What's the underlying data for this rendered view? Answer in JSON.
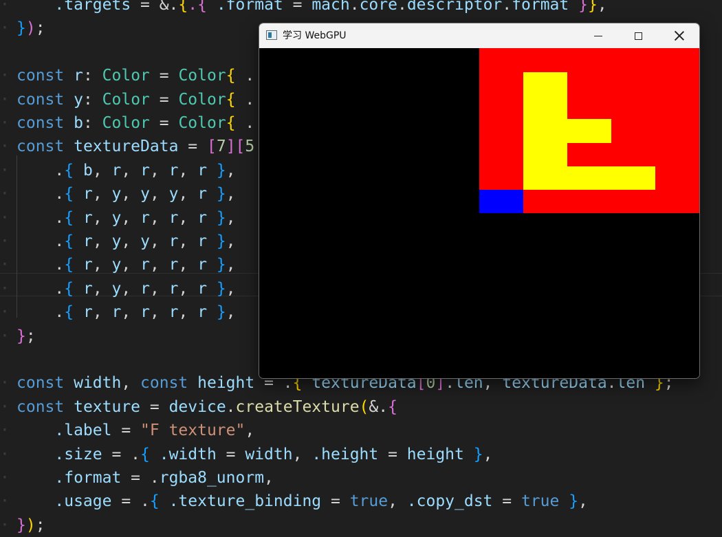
{
  "window": {
    "title": "学习 WebGPU",
    "minimize_label": "Minimize",
    "maximize_label": "Maximize",
    "close_label": "Close"
  },
  "texture_colors": {
    "r": "#ff0000",
    "y": "#ffff00",
    "b": "#0000ff"
  },
  "texture_rows": [
    [
      "b",
      "r",
      "r",
      "r",
      "r"
    ],
    [
      "r",
      "y",
      "y",
      "y",
      "r"
    ],
    [
      "r",
      "y",
      "r",
      "r",
      "r"
    ],
    [
      "r",
      "y",
      "y",
      "r",
      "r"
    ],
    [
      "r",
      "y",
      "r",
      "r",
      "r"
    ],
    [
      "r",
      "y",
      "r",
      "r",
      "r"
    ],
    [
      "r",
      "r",
      "r",
      "r",
      "r"
    ]
  ],
  "code_lines": [
    [
      [
        "t-field",
        "    .targets"
      ],
      [
        "t-op",
        " = &."
      ],
      [
        "t-b1",
        "{"
      ],
      [
        "t-b2",
        ".{"
      ],
      [
        "t-field",
        " .format"
      ],
      [
        "t-op",
        " = "
      ],
      [
        "t-var",
        "mach"
      ],
      [
        "t-op",
        "."
      ],
      [
        "t-var",
        "core"
      ],
      [
        "t-op",
        "."
      ],
      [
        "t-var",
        "descriptor"
      ],
      [
        "t-op",
        "."
      ],
      [
        "t-var",
        "format"
      ],
      [
        "t-b2",
        " }"
      ],
      [
        "t-b1",
        "}"
      ],
      [
        "t-op",
        ","
      ]
    ],
    [
      [
        "t-b3",
        "}"
      ],
      [
        "t-b2",
        ")"
      ],
      [
        "t-op",
        ";"
      ]
    ],
    [],
    [
      [
        "t-kw",
        "const"
      ],
      [
        "t-var",
        " r"
      ],
      [
        "t-op",
        ": "
      ],
      [
        "t-type",
        "Color"
      ],
      [
        "t-op",
        " = "
      ],
      [
        "t-type",
        "Color"
      ],
      [
        "t-b1",
        "{"
      ],
      [
        "t-op",
        " ."
      ]
    ],
    [
      [
        "t-kw",
        "const"
      ],
      [
        "t-var",
        " y"
      ],
      [
        "t-op",
        ": "
      ],
      [
        "t-type",
        "Color"
      ],
      [
        "t-op",
        " = "
      ],
      [
        "t-type",
        "Color"
      ],
      [
        "t-b1",
        "{"
      ],
      [
        "t-op",
        " ."
      ]
    ],
    [
      [
        "t-kw",
        "const"
      ],
      [
        "t-var",
        " b"
      ],
      [
        "t-op",
        ": "
      ],
      [
        "t-type",
        "Color"
      ],
      [
        "t-op",
        " = "
      ],
      [
        "t-type",
        "Color"
      ],
      [
        "t-b1",
        "{"
      ],
      [
        "t-op",
        " ."
      ]
    ],
    [
      [
        "t-kw",
        "const"
      ],
      [
        "t-var",
        " textureData"
      ],
      [
        "t-op",
        " = "
      ],
      [
        "t-b2",
        "["
      ],
      [
        "t-num",
        "7"
      ],
      [
        "t-b2",
        "]"
      ],
      [
        "t-b2",
        "["
      ],
      [
        "t-num",
        "5"
      ]
    ],
    [
      [
        "t-op",
        "    ."
      ],
      [
        "t-b3",
        "{"
      ],
      [
        "t-var",
        " b"
      ],
      [
        "t-op",
        ", "
      ],
      [
        "t-var",
        "r"
      ],
      [
        "t-op",
        ", "
      ],
      [
        "t-var",
        "r"
      ],
      [
        "t-op",
        ", "
      ],
      [
        "t-var",
        "r"
      ],
      [
        "t-op",
        ", "
      ],
      [
        "t-var",
        "r"
      ],
      [
        "t-b3",
        " }"
      ],
      [
        "t-op",
        ","
      ]
    ],
    [
      [
        "t-op",
        "    ."
      ],
      [
        "t-b3",
        "{"
      ],
      [
        "t-var",
        " r"
      ],
      [
        "t-op",
        ", "
      ],
      [
        "t-var",
        "y"
      ],
      [
        "t-op",
        ", "
      ],
      [
        "t-var",
        "y"
      ],
      [
        "t-op",
        ", "
      ],
      [
        "t-var",
        "y"
      ],
      [
        "t-op",
        ", "
      ],
      [
        "t-var",
        "r"
      ],
      [
        "t-b3",
        " }"
      ],
      [
        "t-op",
        ","
      ]
    ],
    [
      [
        "t-op",
        "    ."
      ],
      [
        "t-b3",
        "{"
      ],
      [
        "t-var",
        " r"
      ],
      [
        "t-op",
        ", "
      ],
      [
        "t-var",
        "y"
      ],
      [
        "t-op",
        ", "
      ],
      [
        "t-var",
        "r"
      ],
      [
        "t-op",
        ", "
      ],
      [
        "t-var",
        "r"
      ],
      [
        "t-op",
        ", "
      ],
      [
        "t-var",
        "r"
      ],
      [
        "t-b3",
        " }"
      ],
      [
        "t-op",
        ","
      ]
    ],
    [
      [
        "t-op",
        "    ."
      ],
      [
        "t-b3",
        "{"
      ],
      [
        "t-var",
        " r"
      ],
      [
        "t-op",
        ", "
      ],
      [
        "t-var",
        "y"
      ],
      [
        "t-op",
        ", "
      ],
      [
        "t-var",
        "y"
      ],
      [
        "t-op",
        ", "
      ],
      [
        "t-var",
        "r"
      ],
      [
        "t-op",
        ", "
      ],
      [
        "t-var",
        "r"
      ],
      [
        "t-b3",
        " }"
      ],
      [
        "t-op",
        ","
      ]
    ],
    [
      [
        "t-op",
        "    ."
      ],
      [
        "t-b3",
        "{"
      ],
      [
        "t-var",
        " r"
      ],
      [
        "t-op",
        ", "
      ],
      [
        "t-var",
        "y"
      ],
      [
        "t-op",
        ", "
      ],
      [
        "t-var",
        "r"
      ],
      [
        "t-op",
        ", "
      ],
      [
        "t-var",
        "r"
      ],
      [
        "t-op",
        ", "
      ],
      [
        "t-var",
        "r"
      ],
      [
        "t-b3",
        " }"
      ],
      [
        "t-op",
        ","
      ]
    ],
    [
      [
        "t-op",
        "    ."
      ],
      [
        "t-b3",
        "{"
      ],
      [
        "t-var",
        " r"
      ],
      [
        "t-op",
        ", "
      ],
      [
        "t-var",
        "y"
      ],
      [
        "t-op",
        ", "
      ],
      [
        "t-var",
        "r"
      ],
      [
        "t-op",
        ", "
      ],
      [
        "t-var",
        "r"
      ],
      [
        "t-op",
        ", "
      ],
      [
        "t-var",
        "r"
      ],
      [
        "t-b3",
        " }"
      ],
      [
        "t-op",
        ","
      ]
    ],
    [
      [
        "t-op",
        "    ."
      ],
      [
        "t-b3",
        "{"
      ],
      [
        "t-var",
        " r"
      ],
      [
        "t-op",
        ", "
      ],
      [
        "t-var",
        "r"
      ],
      [
        "t-op",
        ", "
      ],
      [
        "t-var",
        "r"
      ],
      [
        "t-op",
        ", "
      ],
      [
        "t-var",
        "r"
      ],
      [
        "t-op",
        ", "
      ],
      [
        "t-var",
        "r"
      ],
      [
        "t-b3",
        " }"
      ],
      [
        "t-op",
        ","
      ]
    ],
    [
      [
        "t-b2",
        "}"
      ],
      [
        "t-op",
        ";"
      ]
    ],
    [],
    [
      [
        "t-kw",
        "const"
      ],
      [
        "t-var",
        " width"
      ],
      [
        "t-op",
        ", "
      ],
      [
        "t-kw",
        "const"
      ],
      [
        "t-var",
        " height"
      ],
      [
        "t-op",
        " = ."
      ],
      [
        "t-b1",
        "{"
      ],
      [
        "t-var",
        " textureData"
      ],
      [
        "t-b2",
        "["
      ],
      [
        "t-num",
        "0"
      ],
      [
        "t-b2",
        "]"
      ],
      [
        "t-op",
        "."
      ],
      [
        "t-var",
        "len"
      ],
      [
        "t-op",
        ", "
      ],
      [
        "t-var",
        "textureData"
      ],
      [
        "t-op",
        "."
      ],
      [
        "t-var",
        "len"
      ],
      [
        "t-b1",
        " }"
      ],
      [
        "t-op",
        ";"
      ]
    ],
    [
      [
        "t-kw",
        "const"
      ],
      [
        "t-var",
        " texture"
      ],
      [
        "t-op",
        " = "
      ],
      [
        "t-var",
        "device"
      ],
      [
        "t-op",
        "."
      ],
      [
        "t-fn",
        "createTexture"
      ],
      [
        "t-b1",
        "("
      ],
      [
        "t-op",
        "&."
      ],
      [
        "t-b2",
        "{"
      ]
    ],
    [
      [
        "t-field",
        "    .label"
      ],
      [
        "t-op",
        " = "
      ],
      [
        "t-str",
        "\"F texture\""
      ],
      [
        "t-op",
        ","
      ]
    ],
    [
      [
        "t-field",
        "    .size"
      ],
      [
        "t-op",
        " = ."
      ],
      [
        "t-b3",
        "{"
      ],
      [
        "t-field",
        " .width"
      ],
      [
        "t-op",
        " = "
      ],
      [
        "t-var",
        "width"
      ],
      [
        "t-op",
        ", "
      ],
      [
        "t-field",
        ".height"
      ],
      [
        "t-op",
        " = "
      ],
      [
        "t-var",
        "height"
      ],
      [
        "t-b3",
        " }"
      ],
      [
        "t-op",
        ","
      ]
    ],
    [
      [
        "t-field",
        "    .format"
      ],
      [
        "t-op",
        " = ."
      ],
      [
        "t-var",
        "rgba8_unorm"
      ],
      [
        "t-op",
        ","
      ]
    ],
    [
      [
        "t-field",
        "    .usage"
      ],
      [
        "t-op",
        " = ."
      ],
      [
        "t-b3",
        "{"
      ],
      [
        "t-field",
        " .texture_binding"
      ],
      [
        "t-op",
        " = "
      ],
      [
        "t-kw",
        "true"
      ],
      [
        "t-op",
        ", "
      ],
      [
        "t-field",
        ".copy_dst"
      ],
      [
        "t-op",
        " = "
      ],
      [
        "t-kw",
        "true"
      ],
      [
        "t-b3",
        " }"
      ],
      [
        "t-op",
        ","
      ]
    ],
    [
      [
        "t-b2",
        "}"
      ],
      [
        "t-b1",
        ")"
      ],
      [
        "t-op",
        ";"
      ]
    ]
  ]
}
